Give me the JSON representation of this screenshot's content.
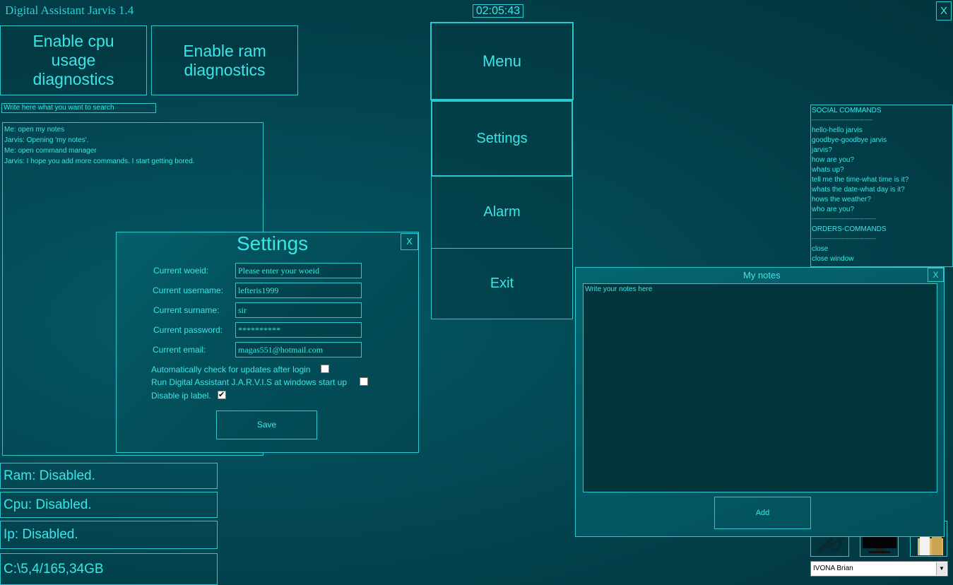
{
  "window": {
    "title": "Digital Assistant Jarvis 1.4",
    "clock": "02:05:43",
    "close_label": "X"
  },
  "diagnostics": {
    "cpu_button": "Enable cpu usage diagnostics",
    "ram_button": "Enable ram diagnostics"
  },
  "search": {
    "placeholder": "Write here what you want to search"
  },
  "chat": {
    "lines": [
      "Me: open my notes",
      "Jarvis: Opening 'my notes'.",
      "Me: open command manager",
      "Jarvis: I hope you add more commands. I start getting bored."
    ]
  },
  "status": {
    "ram": "Ram: Disabled.",
    "cpu": "Cpu: Disabled.",
    "ip": "Ip: Disabled.",
    "disk": "C:\\5,4/165,34GB"
  },
  "menu": {
    "items": [
      "Menu",
      "Settings",
      "Alarm",
      "Exit"
    ]
  },
  "settings_dialog": {
    "title": "Settings",
    "close_label": "X",
    "fields": [
      {
        "label": "Current woeid:",
        "value": "Please enter your woeid"
      },
      {
        "label": "Current username:",
        "value": "lefteris1999"
      },
      {
        "label": "Current surname:",
        "value": "sir"
      },
      {
        "label": "Current password:",
        "value": "**********"
      },
      {
        "label": "Current email:",
        "value": "magas551@hotmail.com"
      }
    ],
    "options": [
      {
        "label": "Automatically check for updates after login",
        "checked": false
      },
      {
        "label": "Run Digital Assistant J.A.R.V.I.S at windows start up",
        "checked": false
      },
      {
        "label": "Disable ip label.",
        "checked": true
      }
    ],
    "save_label": "Save"
  },
  "commands": {
    "lines": [
      "SOCIAL COMMANDS",
      "-------------------------------------",
      "hello-hello jarvis",
      "goodbye-goodbye jarvis",
      "jarvis?",
      "how are you?",
      "whats up?",
      "tell me the time-what time is it?",
      "whats the date-what day is it?",
      "hows the weather?",
      "who are you?",
      "---------------------------------------",
      "ORDERS-COMMANDS",
      "---------------------------------------",
      "close",
      "close window"
    ]
  },
  "notes_dialog": {
    "title": "My notes",
    "close_label": "X",
    "placeholder": "Write your notes here",
    "add_label": "Add"
  },
  "tray_icons": [
    "microphone-muted-icon",
    "monitor-icon",
    "folder-icon"
  ],
  "voice_select": {
    "value": "IVONA Brian",
    "arrow": "▼"
  },
  "colors": {
    "accent": "#29c9d2",
    "text": "#3be6e6",
    "background": "#034a56"
  }
}
